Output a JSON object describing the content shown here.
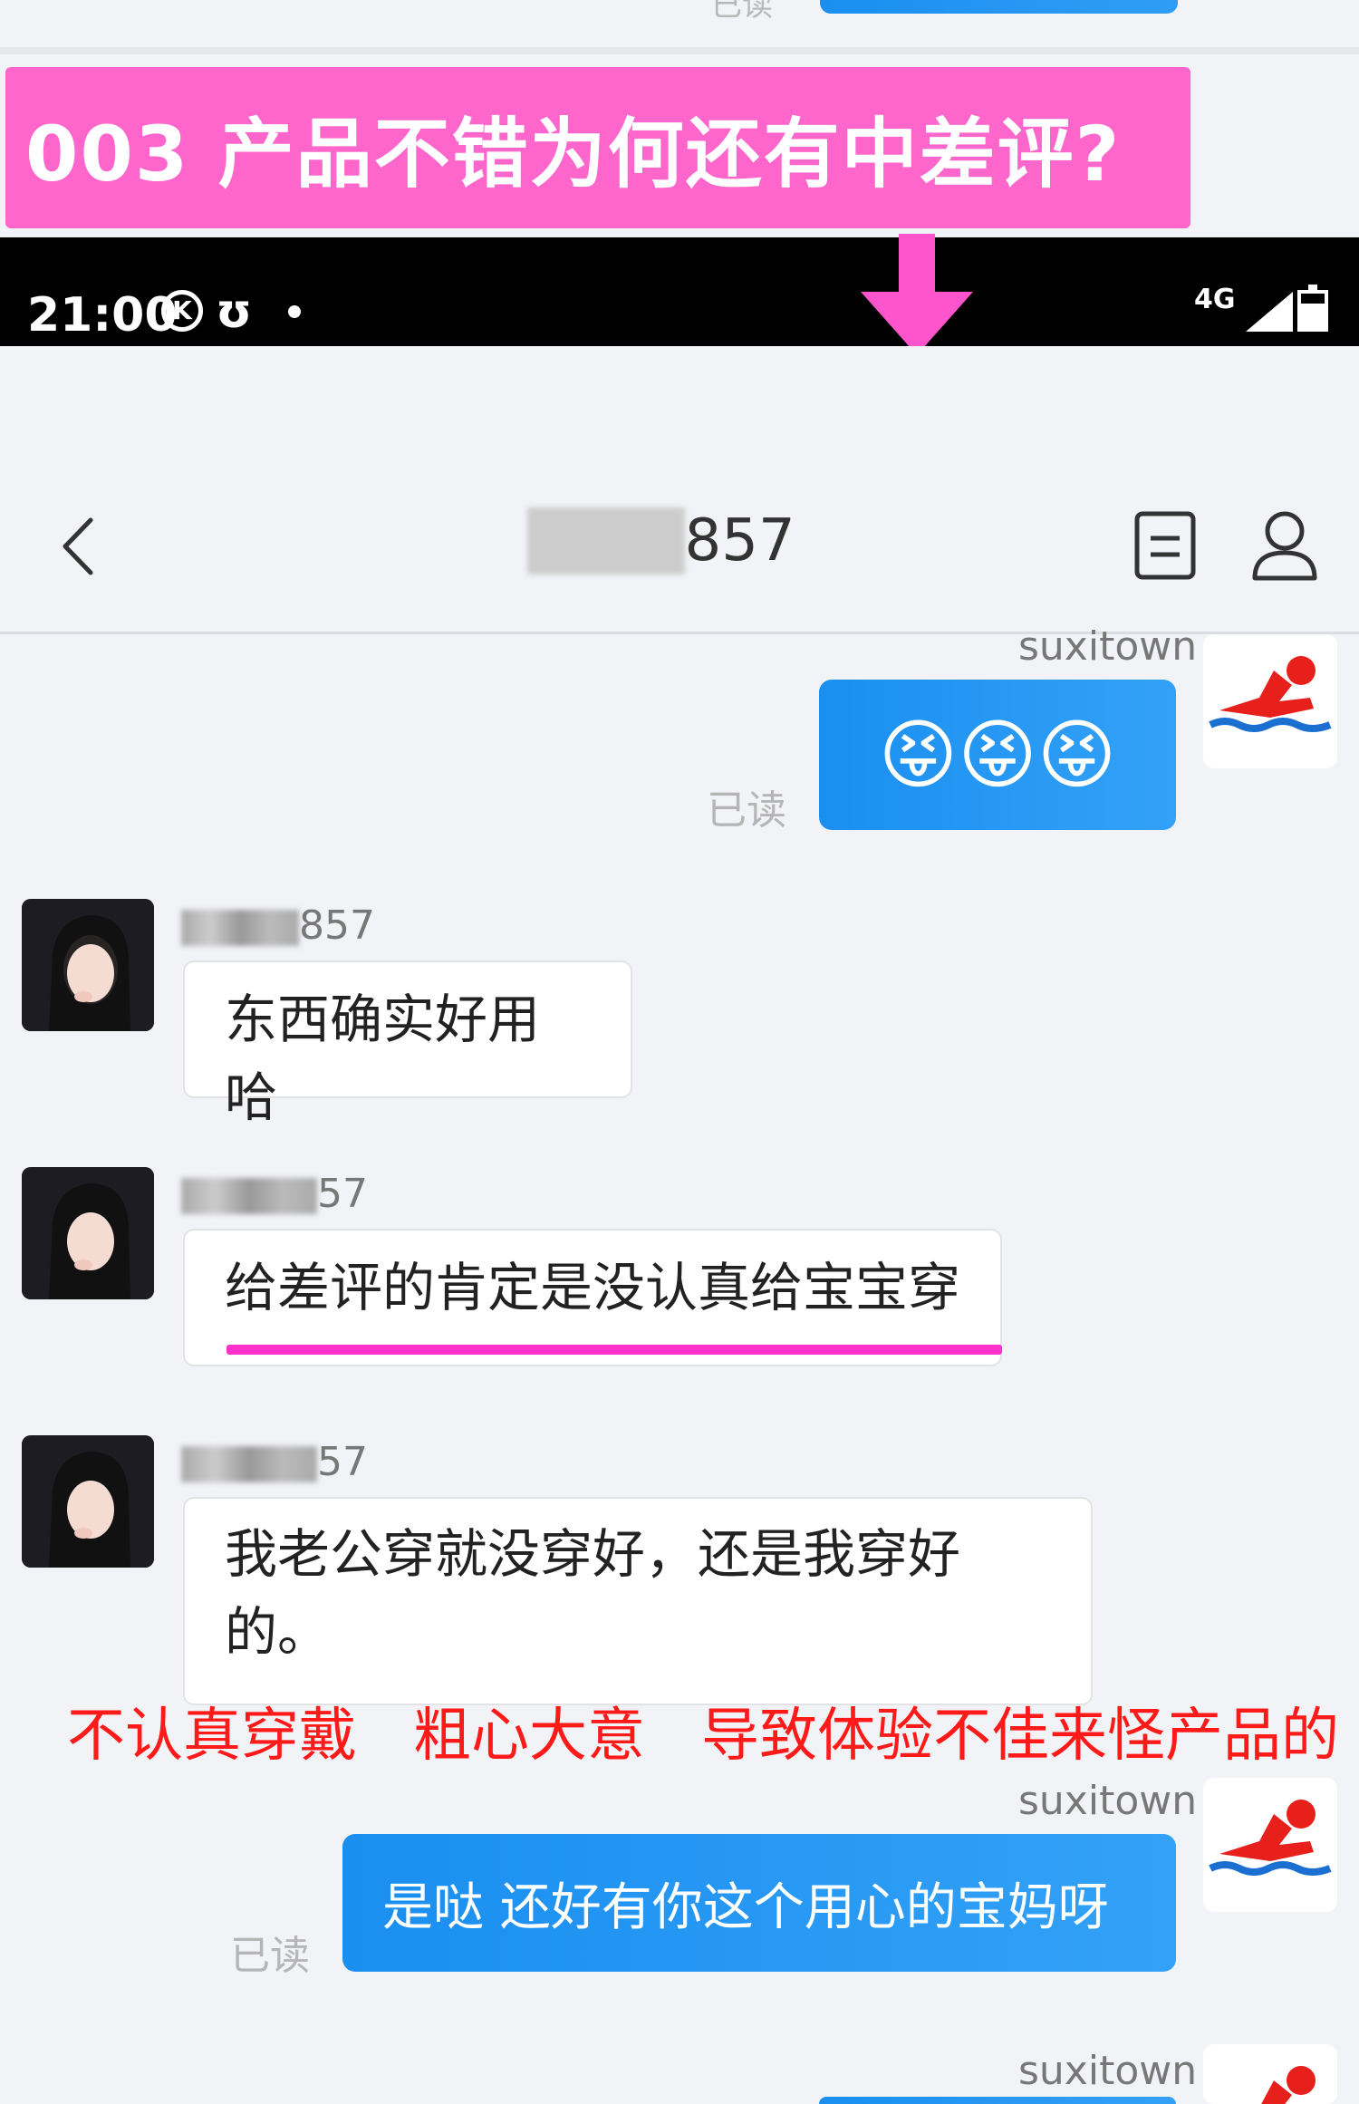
{
  "top_strip": {
    "read_label": "已读"
  },
  "banner": {
    "text": "003 产品不错为何还有中差评?",
    "color": "#ff66cc"
  },
  "status_bar": {
    "time": "21:00",
    "k_icon": "K",
    "network": "4G"
  },
  "header": {
    "title_visible": "857",
    "title_blurred": "lz611",
    "back_icon": "chevron-left-icon",
    "doc_icon": "document-icon",
    "user_icon": "user-icon"
  },
  "messages": [
    {
      "side": "right",
      "sender": "suxitown",
      "content": "😝😝😝",
      "read": "已读"
    },
    {
      "side": "left",
      "sender_visible": "857",
      "content": "东西确实好用哈"
    },
    {
      "side": "left",
      "sender_visible": "57",
      "content": "给差评的肯定是没认真给宝宝穿"
    },
    {
      "side": "left",
      "sender_visible": "57",
      "content_line1": "我老公穿就没穿好，还是我穿好",
      "content_line2": "的。"
    },
    {
      "side": "right",
      "sender": "suxitown",
      "content": "是哒 还好有你这个用心的宝妈呀",
      "read": "已读"
    },
    {
      "side": "right",
      "sender": "suxitown"
    }
  ],
  "annotation": {
    "parts": [
      "不认真穿戴",
      "粗心大意",
      "导致体验不佳来怪产品的"
    ],
    "color": "#ff1a1a"
  },
  "colors": {
    "bubble_blue": "#1a8ff0",
    "highlight_pink": "#ff33cc",
    "background": "#f2f3f7"
  }
}
